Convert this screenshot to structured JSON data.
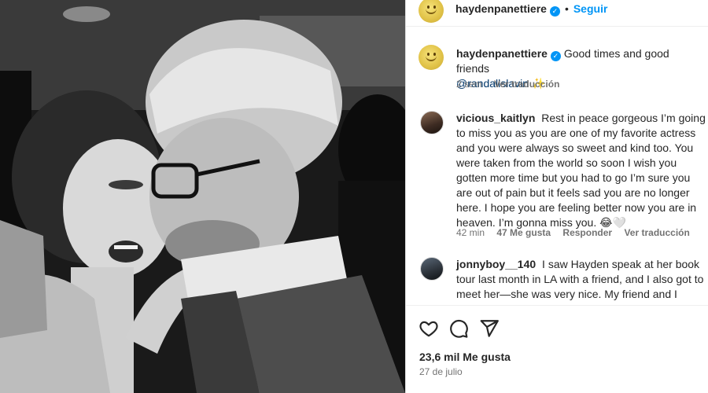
{
  "post": {
    "author": "haydenpanettiere",
    "follow_label": "Seguir",
    "separator": "•"
  },
  "caption": {
    "author": "haydenpanettiere",
    "text": "Good times and good friends",
    "mention": "@randallslavin",
    "emoji": "✨",
    "time": "2 sem",
    "translate_label": "Ver traducción"
  },
  "comments": [
    {
      "author": "vicious_kaitlyn",
      "text": "Rest in peace gorgeous I’m going to miss you as you are one of my favorite actress and you were always so sweet and kind too. You were taken from the world so soon I wish you gotten more time but you had to go I’m sure you are out of pain but it feels sad you are no longer here. I hope you are feeling better now you are in heaven. I’m gonna miss you. 😂🤍",
      "time": "42 min",
      "likes": "47 Me gusta",
      "reply_label": "Responder",
      "translate_label": "Ver traducción"
    },
    {
      "author": "jonnyboy__140",
      "text": "I saw Hayden speak at her book tour last month in LA with a friend, and I also got to meet her—she was very nice. My friend and I literally said to each other that she didn't sound"
    }
  ],
  "footer": {
    "likes_count": "23,6 mil Me gusta",
    "date": "27 de julio"
  },
  "icons": {
    "like": "heart-icon",
    "comment": "comment-icon",
    "share": "send-icon"
  }
}
